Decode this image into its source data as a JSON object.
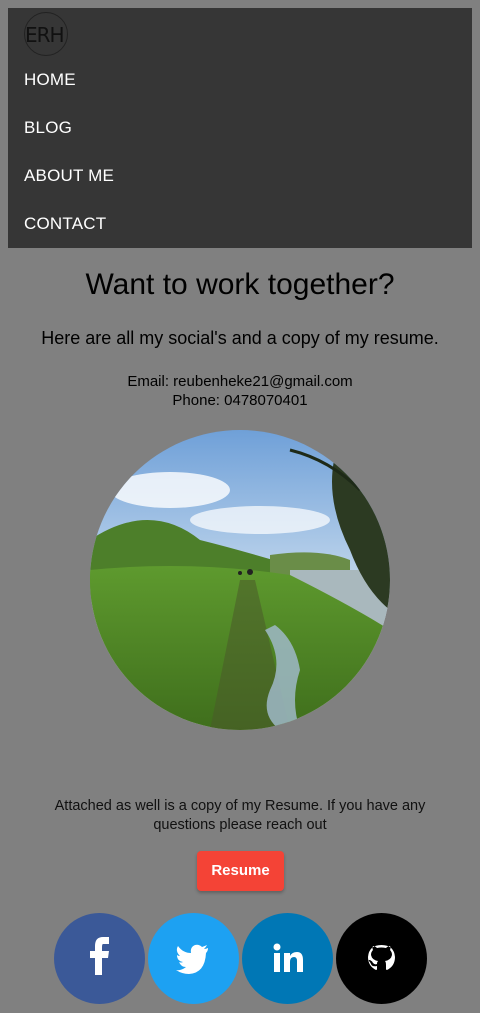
{
  "nav": {
    "logo_text": "ERH",
    "items": [
      {
        "label": "HOME"
      },
      {
        "label": "BLOG"
      },
      {
        "label": "ABOUT ME"
      },
      {
        "label": "CONTACT"
      }
    ]
  },
  "main": {
    "title": "Want to work together?",
    "subtitle": "Here are all my social's and a copy of my resume.",
    "email_line": "Email: reubenheke21@gmail.com",
    "phone_line": "Phone: 0478070401",
    "attached_text": "Attached as well is a copy of my Resume. If you have any questions please reach out",
    "resume_button": "Resume"
  },
  "social": [
    {
      "icon": "facebook-icon",
      "color": "#3b5998"
    },
    {
      "icon": "twitter-icon",
      "color": "#1da1f2"
    },
    {
      "icon": "linkedin-icon",
      "color": "#0077b5"
    },
    {
      "icon": "github-icon",
      "color": "#000000"
    }
  ],
  "colors": {
    "page_bg": "#808080",
    "nav_bg": "#363636",
    "resume_button": "#f44336"
  }
}
